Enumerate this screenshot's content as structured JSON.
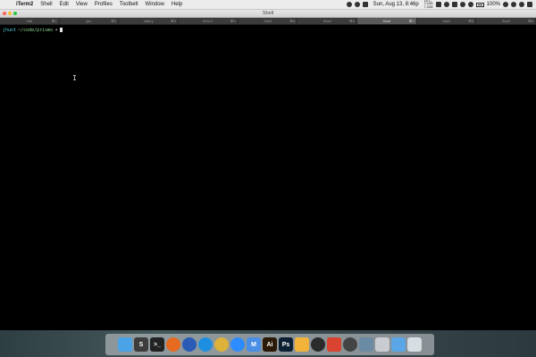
{
  "menubar": {
    "apple_glyph": "",
    "app_name": "iTerm2",
    "items": [
      "Shell",
      "Edit",
      "View",
      "Profiles",
      "Toolbelt",
      "Window",
      "Help"
    ],
    "clock": "Sun, Aug 13, 8:46p",
    "stats": "18°C\n2.3GB\n7.3GB",
    "battery_percent": "100%"
  },
  "window": {
    "title": "Shell"
  },
  "tabs": [
    {
      "name": "VIM",
      "key": "⌘1"
    },
    {
      "name": "jslo",
      "key": "⌘2"
    },
    {
      "name": "lottery",
      "key": "⌘3"
    },
    {
      "name": "BOLO",
      "key": "⌘4"
    },
    {
      "name": "Shell",
      "key": "⌘5"
    },
    {
      "name": "Shell",
      "key": "⌘6"
    },
    {
      "name": "Shell",
      "key": "⌘7"
    },
    {
      "name": "Shell",
      "key": "⌘8"
    },
    {
      "name": "Shell",
      "key": "⌘9"
    }
  ],
  "terminal": {
    "user": "jhunt",
    "path": "~/code/prismo",
    "arrow": "➜"
  },
  "dock": {
    "icons": [
      {
        "name": "finder",
        "label": "",
        "color": "#4aa3e6"
      },
      {
        "name": "sublime-text",
        "label": "S",
        "color": "#3d3d3d"
      },
      {
        "name": "terminal",
        "label": ">_",
        "color": "#222222"
      },
      {
        "name": "firefox",
        "label": "",
        "color": "#e66a1f"
      },
      {
        "name": "firefox-dev",
        "label": "",
        "color": "#2a5bb5"
      },
      {
        "name": "safari",
        "label": "",
        "color": "#1e8fe0"
      },
      {
        "name": "chrome",
        "label": "",
        "color": "#ddb23b"
      },
      {
        "name": "zoom",
        "label": "",
        "color": "#2d8cff"
      },
      {
        "name": "mail",
        "label": "M",
        "color": "#4a8fe6"
      },
      {
        "name": "illustrator",
        "label": "Ai",
        "color": "#2b1a07"
      },
      {
        "name": "photoshop",
        "label": "Ps",
        "color": "#0d1f33"
      },
      {
        "name": "sketch",
        "label": "",
        "color": "#f2b33b"
      },
      {
        "name": "obs",
        "label": "",
        "color": "#2b2b2b"
      },
      {
        "name": "git-app",
        "label": "",
        "color": "#d9432f"
      },
      {
        "name": "globe-app",
        "label": "",
        "color": "#444444"
      },
      {
        "name": "preview",
        "label": "",
        "color": "#6b8aa3"
      },
      {
        "name": "keyboard",
        "label": "",
        "color": "#c9ccd0"
      },
      {
        "name": "folder",
        "label": "",
        "color": "#5aa6e6"
      },
      {
        "name": "trash",
        "label": "",
        "color": "#d8dde2"
      }
    ]
  }
}
